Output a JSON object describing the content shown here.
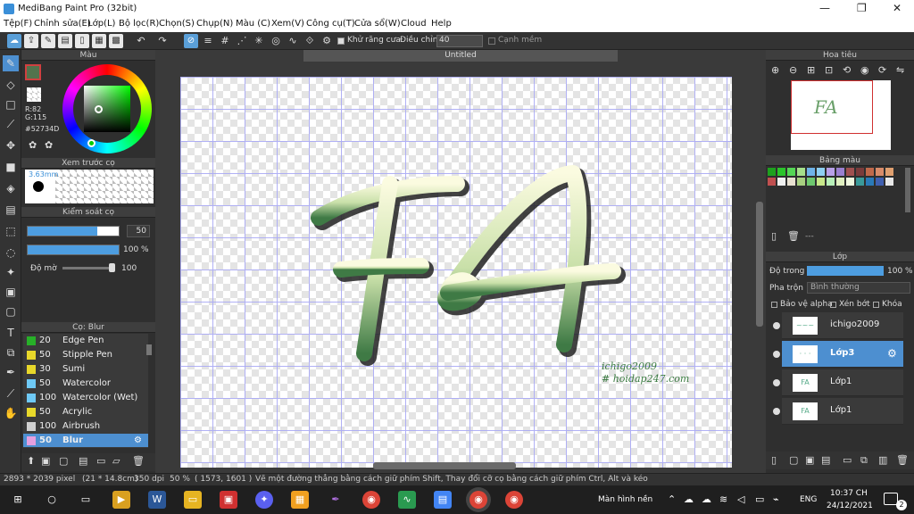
{
  "window": {
    "title": "MediBang Paint Pro (32bit)",
    "min": "—",
    "max": "❐",
    "close": "✕"
  },
  "menu": [
    "Tệp(F)",
    "Chỉnh sửa(E)",
    "Lớp(L)",
    "Bộ lọc(R)",
    "Chọn(S)",
    "Chụp(N)",
    "Màu (C)",
    "Xem(V)",
    "Công cụ(T)",
    "Cửa sổ(W)",
    "Cloud",
    "Help"
  ],
  "toolbar": {
    "antialias": "Khử răng cưa",
    "adjust_label": "Điều chỉnh",
    "adjust_value": "40",
    "smooth": "Cạnh mềm"
  },
  "color_panel": {
    "title": "Màu",
    "r": "R:82",
    "g": "G:115",
    "b": "B:77",
    "hex": "#52734D",
    "current": "#52734D"
  },
  "brush_preview": {
    "title": "Xem trước cọ",
    "size": "3.63mm"
  },
  "brush_control": {
    "title": "Kiểm soát cọ",
    "size_value": "50",
    "percent_value": "100 %",
    "opacity_label": "Độ mờ",
    "opacity_value": "100"
  },
  "brush_list": {
    "title": "Cọ: Blur",
    "items": [
      {
        "size": "20",
        "name": "Edge Pen",
        "color": "#27b028"
      },
      {
        "size": "50",
        "name": "Stipple Pen",
        "color": "#e8d82a"
      },
      {
        "size": "30",
        "name": "Sumi",
        "color": "#e8d82a"
      },
      {
        "size": "50",
        "name": "Watercolor",
        "color": "#6ec9f5"
      },
      {
        "size": "100",
        "name": "Watercolor (Wet)",
        "color": "#6ec9f5"
      },
      {
        "size": "50",
        "name": "Acrylic",
        "color": "#e8d82a"
      },
      {
        "size": "100",
        "name": "Airbrush",
        "color": "#cfcfcf"
      },
      {
        "size": "50",
        "name": "Blur",
        "color": "#e4a0e0"
      }
    ]
  },
  "canvas": {
    "tab_title": "Untitled",
    "art_text": "FA",
    "credit_line1": "ichigo2009",
    "credit_line2": "# hoidap247.com"
  },
  "navigator": {
    "title": "Hoa tiêu"
  },
  "palette": {
    "title": "Bảng màu",
    "more": "---",
    "colors": [
      "#1ea01e",
      "#2bc42b",
      "#55d655",
      "#a5e08a",
      "#6fb3e8",
      "#8ecff2",
      "#b8a0e8",
      "#9a7fcf",
      "#a05050",
      "#7a3b3b",
      "#c0694b",
      "#d98c6a",
      "#e0a070",
      "#c05050",
      "#f0f0f0",
      "#e8e0d0",
      "#a8d080",
      "#6ec86e",
      "#c8e88a",
      "#b8f0b8",
      "#e0f0c0",
      "#f0f8e0",
      "#3a9a9a",
      "#2a7ab8",
      "#4060b0",
      "#e8e8e8"
    ]
  },
  "layers": {
    "title": "Lớp",
    "opacity_label": "Độ trong",
    "opacity_value": "100 %",
    "blend_label": "Pha trộn",
    "blend_value": "Bình thường",
    "protect_alpha": "Bảo vệ alpha",
    "clipping": "Xén bớt",
    "lock": "Khóa",
    "items": [
      {
        "name": "ichigo2009",
        "thumb": "~~~",
        "selected": false
      },
      {
        "name": "Lớp3",
        "thumb": "· · ·",
        "selected": true
      },
      {
        "name": "Lớp1",
        "thumb": "FA",
        "selected": false
      },
      {
        "name": "Lớp1",
        "thumb": "FA",
        "selected": false
      }
    ]
  },
  "status": {
    "dimensions": "2893 * 2039 pixel",
    "size_cm": "(21 * 14.8cm)",
    "dpi": "350 dpi",
    "zoom": "50 %",
    "coords": "( 1573, 1601 )",
    "hint": "Vẽ một đường thẳng bằng cách giữ phím Shift, Thay đổi cỡ cọ bằng cách giữ phím Ctrl, Alt và kéo"
  },
  "taskbar": {
    "desktop": "Màn hình nền",
    "lang": "ENG",
    "time": "10:37 CH",
    "date": "24/12/2021",
    "notif": "2"
  }
}
